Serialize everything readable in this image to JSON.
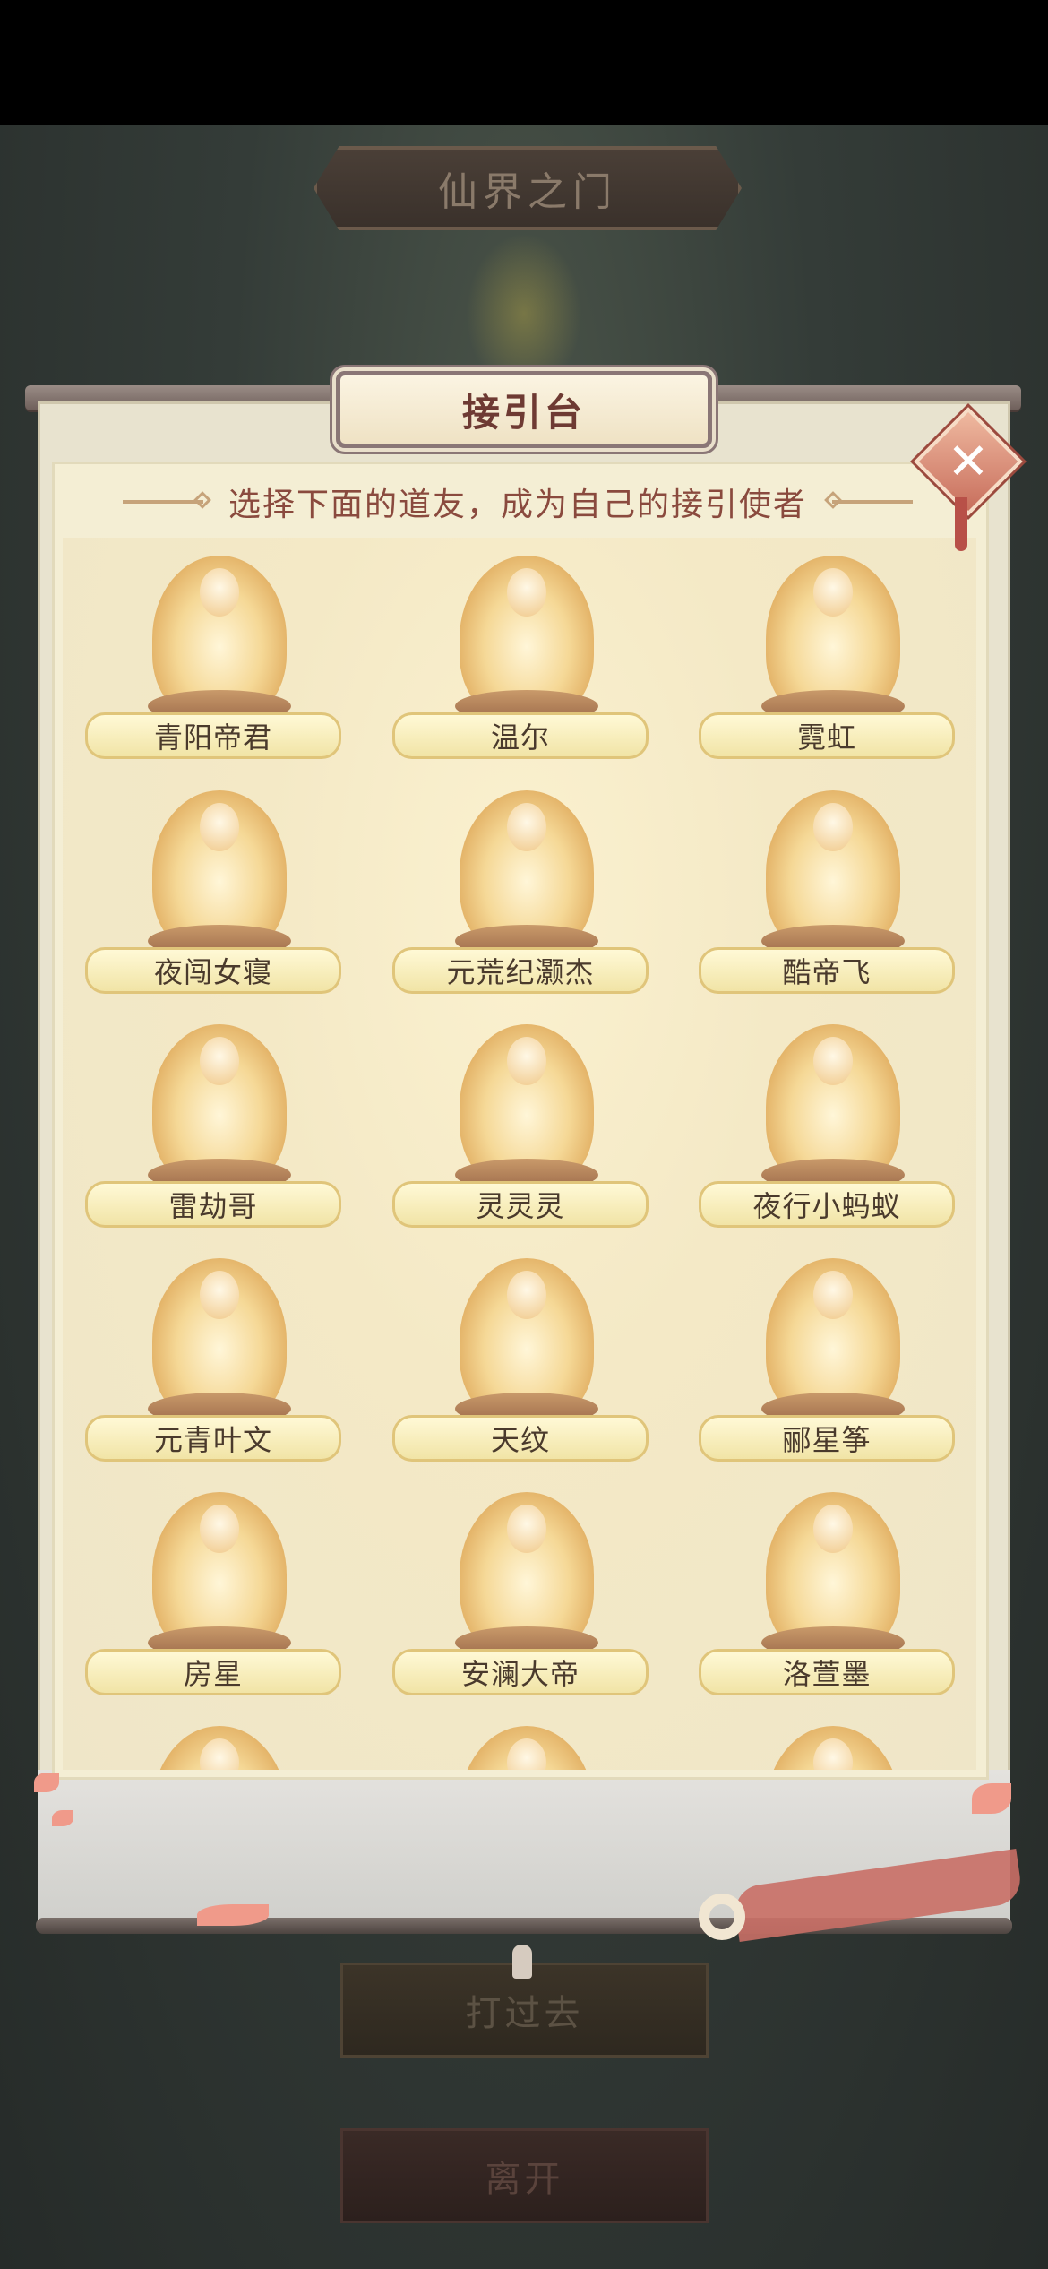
{
  "gate_title": "仙界之门",
  "panel": {
    "title": "接引台",
    "prompt": "选择下面的道友，成为自己的接引使者",
    "close_symbol": "✕"
  },
  "candidates": [
    "青阳帝君",
    "温尔",
    "霓虹",
    "夜闯女寝",
    "元荒纪灏杰",
    "酷帝飞",
    "雷劫哥",
    "灵灵灵",
    "夜行小蚂蚁",
    "元青叶文",
    "天纹",
    "郦星筝",
    "房星",
    "安澜大帝",
    "洛萱墨"
  ],
  "buttons": {
    "open": "打过去",
    "leave": "离开"
  },
  "icons": {
    "close": "close-icon",
    "statue": "seated-deity-statue-icon"
  }
}
